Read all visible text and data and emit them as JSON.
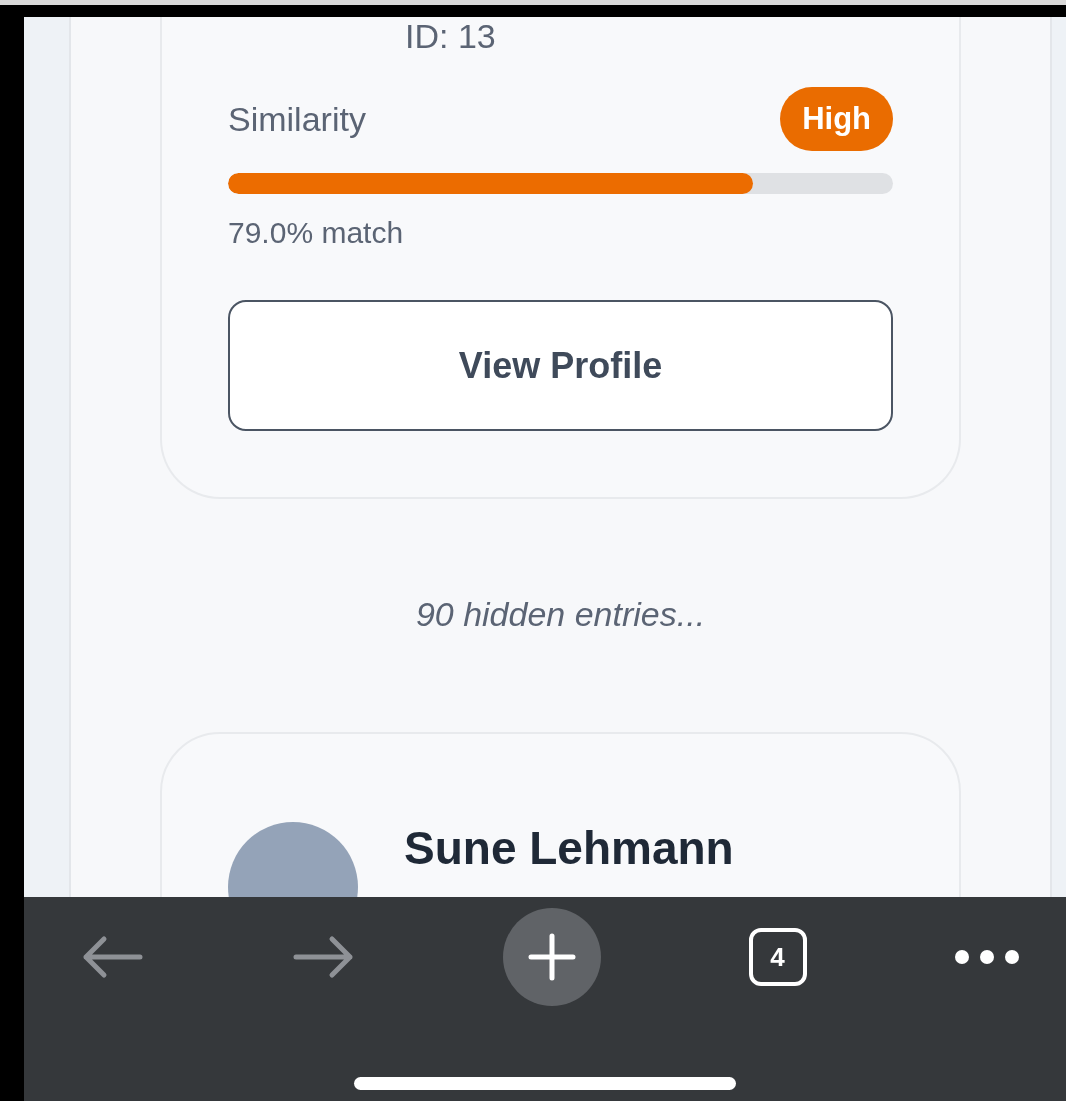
{
  "card": {
    "id_label": "ID: 13",
    "similarity_label": "Similarity",
    "badge": "High",
    "level": 0.79,
    "match": "79.0% match",
    "button": "View Profile"
  },
  "hidden_note": "90 hidden entries...",
  "next_card": {
    "name": "Sune Lehmann"
  },
  "toolbar": {
    "tab_count": "4"
  }
}
